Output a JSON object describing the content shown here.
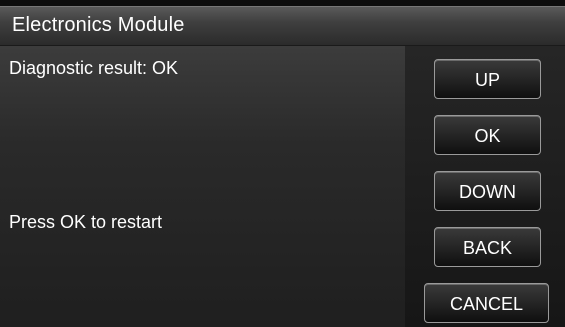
{
  "header": {
    "title": "Electronics Module"
  },
  "content": {
    "result_text": "Diagnostic result: OK",
    "instruction_text": "Press OK to restart"
  },
  "buttons": {
    "up": "UP",
    "ok": "OK",
    "down": "DOWN",
    "back": "BACK",
    "cancel": "CANCEL"
  },
  "colors": {
    "text": "#ffffff",
    "background": "#0d0d0d",
    "button_border": "#9a9a9a"
  }
}
